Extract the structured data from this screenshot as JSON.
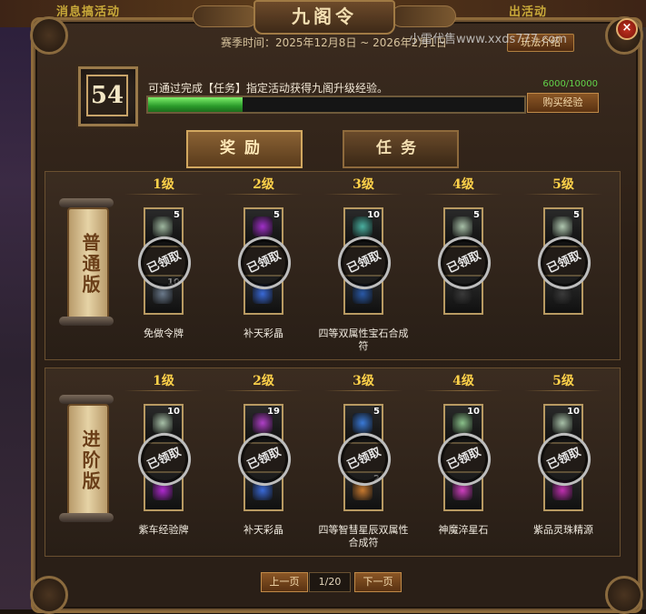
{
  "header": {
    "title": "九阁令",
    "season": "赛季时间：2025年12月8日 ~ 2026年2月1日",
    "rules_button": "玩法介绍",
    "close_label": "×",
    "watermark": "小雷代售www.xxds777.com",
    "background_text_left": "消息搞活动",
    "background_text_right": "出活动"
  },
  "progress": {
    "level": "54",
    "description": "可通过完成【任务】指定活动获得九阁升级经验。",
    "exp_text": "6000/10000",
    "exp_fraction": 0.6,
    "buy_button": "购买经验"
  },
  "tabs": [
    {
      "label": "奖励",
      "active": true
    },
    {
      "label": "任务",
      "active": false
    }
  ],
  "tracks": [
    {
      "label": "普通版",
      "levels": [
        "1级",
        "2级",
        "3级",
        "4级",
        "5级"
      ],
      "items": [
        {
          "name": "免做令牌",
          "top_count": "5",
          "bottom_count": "10",
          "top_color": "#9fb8a0",
          "bottom_color": "#6b7a8c",
          "stamp": "已领取"
        },
        {
          "name": "补天彩晶",
          "top_count": "5",
          "bottom_count": "",
          "top_color": "#a030c8",
          "bottom_color": "#3a6ad8",
          "stamp": "已领取"
        },
        {
          "name": "四等双属性宝石合成符",
          "top_count": "10",
          "bottom_count": "",
          "top_color": "#4ab0a0",
          "bottom_color": "#2a5aa8",
          "stamp": "已领取"
        },
        {
          "name": "",
          "top_count": "5",
          "bottom_count": "",
          "top_color": "#a8c0a8",
          "bottom_color": "#3a3a3a",
          "stamp": "已领取"
        },
        {
          "name": "",
          "top_count": "5",
          "bottom_count": "",
          "top_color": "#b0c8b0",
          "bottom_color": "#3a3a3a",
          "stamp": "已领取"
        }
      ]
    },
    {
      "label": "进阶版",
      "levels": [
        "1级",
        "2级",
        "3级",
        "4级",
        "5级"
      ],
      "items": [
        {
          "name": "紫车经验牌",
          "top_count": "10",
          "bottom_count": "",
          "top_color": "#a8c0a8",
          "bottom_color": "#b02ad0",
          "stamp": "已领取"
        },
        {
          "name": "补天彩晶",
          "top_count": "19",
          "bottom_count": "",
          "top_color": "#b040c8",
          "bottom_color": "#3a6ad8",
          "stamp": "已领取"
        },
        {
          "name": "四等智彗星辰双属性合成符",
          "top_count": "5",
          "bottom_count": "2",
          "top_color": "#3a7ad8",
          "bottom_color": "#c87a30",
          "stamp": "已领取"
        },
        {
          "name": "神魔淬星石",
          "top_count": "10",
          "bottom_count": "",
          "top_color": "#8ac08a",
          "bottom_color": "#d040c0",
          "stamp": "已领取"
        },
        {
          "name": "紫品灵珠精源",
          "top_count": "10",
          "bottom_count": "",
          "top_color": "#a8c0a8",
          "bottom_color": "#c030b0",
          "stamp": "已领取"
        }
      ]
    }
  ],
  "pager": {
    "prev": "上一页",
    "page": "1/20",
    "next": "下一页"
  }
}
